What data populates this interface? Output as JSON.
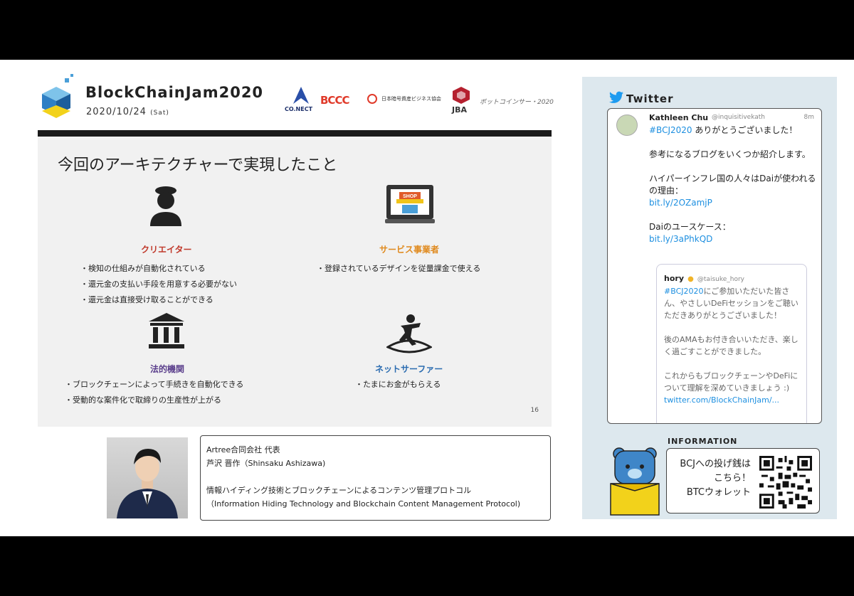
{
  "header": {
    "event_title": "BlockChainJam2020",
    "event_date": "2020/10/24",
    "event_day": "(Sat)",
    "sponsors": [
      "CO.NECT",
      "BCCC",
      "日本暗号資産ビジネス協会",
      "JBA",
      "ボットコインサー・2020"
    ]
  },
  "slide": {
    "heading": "今回のアーキテクチャーで実現したこと",
    "page_number": "16",
    "roles": [
      {
        "label": "クリエイター",
        "icon": "creator-icon",
        "color": "#c0392b",
        "bullets": [
          "・検知の仕組みが自動化されている",
          "・還元金の支払い手段を用意する必要がない",
          "・還元金は直接受け取ることができる"
        ]
      },
      {
        "label": "サービス事業者",
        "icon": "shop-icon",
        "color": "#e08a1e",
        "bullets": [
          "・登録されているデザインを従量課金で使える"
        ]
      },
      {
        "label": "法的機関",
        "icon": "court-icon",
        "color": "#5b3f8c",
        "bullets": [
          "・ブロックチェーンによって手続きを自動化できる",
          "・受動的な案件化で取締りの生産性が上がる"
        ]
      },
      {
        "label": "ネットサーファー",
        "icon": "surfer-icon",
        "color": "#2b6cb0",
        "bullets": [
          "・たまにお金がもらえる"
        ]
      }
    ]
  },
  "speaker": {
    "org": "Artree合同会社 代表",
    "name": "芦沢 晋作（Shinsaku Ashizawa)",
    "talk_title_ja": "情報ハイディング技術とブロックチェーンによるコンテンツ管理プロトコル",
    "talk_title_en": "（Information Hiding Technology and Blockchain Content Management Protocol)"
  },
  "twitter": {
    "header": "Twitter",
    "tweet": {
      "name": "Kathleen Chu",
      "handle": "@inquisitivekath",
      "time": "8m",
      "hashtag": "#BCJ2020",
      "line1": " ありがとうございました！",
      "para2": "参考になるブログをいくつか紹介します。",
      "para3": "ハイパーインフレ国の人々はDaiが使われるの理由：",
      "link1": "bit.ly/2OZamjP",
      "para4": "Daiのユースケース：",
      "link2": "bit.ly/3aPhkQD"
    },
    "quote": {
      "name": "hory",
      "handle": "@taisuke_hory",
      "hashtag": "#BCJ2020",
      "text1": "にご参加いただいた皆さん、やさしいDeFiセッションをご聴いただきありがとうございました！",
      "text2": "後のAMAもお付き合いいただき、楽しく過ごすことができました。",
      "text3": "これからもブロックチェーンやDeFiについて理解を深めていきましょう :)",
      "link": "twitter.com/BlockChainJam/..."
    }
  },
  "information": {
    "label": "INFORMATION",
    "line1": "BCJへの投げ銭は",
    "line2": "こちら！",
    "line3": "BTCウォレット"
  }
}
